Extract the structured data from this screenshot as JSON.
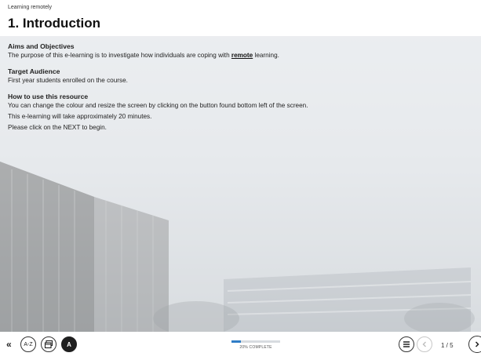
{
  "header": {
    "course_title": "Learning remotely",
    "page_title": "1. Introduction"
  },
  "content": {
    "sections": [
      {
        "heading": "Aims and Objectives",
        "text_before": "The purpose of this e-learning is to investigate how individuals are coping with ",
        "link": "remote",
        "text_after": " learning."
      },
      {
        "heading": "Target Audience",
        "text": "First year students enrolled on the course."
      },
      {
        "heading": "How to use this resource",
        "lines": [
          "You can change the colour and resize the screen by clicking on the button found bottom left of the screen.",
          "This e-learning will take approximately 20 minutes.",
          "Please click on the NEXT to begin."
        ]
      }
    ]
  },
  "footer": {
    "collapse_label": "«",
    "glossary_label": "A-Z",
    "accessibility_label": "A",
    "progress_percent": 20,
    "progress_label": "20% COMPLETE",
    "page_counter": "1 / 5"
  },
  "colors": {
    "accent": "#2f7dc7",
    "dark_button": "#1f1f1f"
  }
}
